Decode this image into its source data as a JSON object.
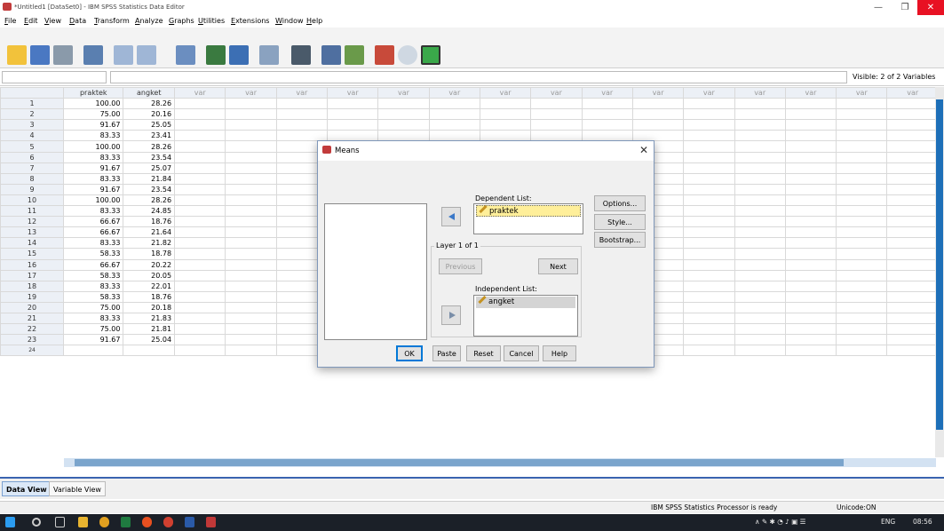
{
  "window": {
    "title": "*Untitled1 [DataSet0] - IBM SPSS Statistics Data Editor",
    "minimize": "—",
    "restore": "❐",
    "close": "✕"
  },
  "menu": [
    "File",
    "Edit",
    "View",
    "Data",
    "Transform",
    "Analyze",
    "Graphs",
    "Utilities",
    "Extensions",
    "Window",
    "Help"
  ],
  "visible": "Visible: 2 of 2 Variables",
  "grid": {
    "headers": [
      "praktek",
      "angket",
      "var",
      "var",
      "var",
      "var",
      "var",
      "var",
      "var",
      "var",
      "var",
      "var",
      "var",
      "var",
      "var",
      "var",
      "var"
    ],
    "rows": [
      [
        "1",
        "100.00",
        "28.26"
      ],
      [
        "2",
        "75.00",
        "20.16"
      ],
      [
        "3",
        "91.67",
        "25.05"
      ],
      [
        "4",
        "83.33",
        "23.41"
      ],
      [
        "5",
        "100.00",
        "28.26"
      ],
      [
        "6",
        "83.33",
        "23.54"
      ],
      [
        "7",
        "91.67",
        "25.07"
      ],
      [
        "8",
        "83.33",
        "21.84"
      ],
      [
        "9",
        "91.67",
        "23.54"
      ],
      [
        "10",
        "100.00",
        "28.26"
      ],
      [
        "11",
        "83.33",
        "24.85"
      ],
      [
        "12",
        "66.67",
        "18.76"
      ],
      [
        "13",
        "66.67",
        "21.64"
      ],
      [
        "14",
        "83.33",
        "21.82"
      ],
      [
        "15",
        "58.33",
        "18.78"
      ],
      [
        "16",
        "66.67",
        "20.22"
      ],
      [
        "17",
        "58.33",
        "20.05"
      ],
      [
        "18",
        "83.33",
        "22.01"
      ],
      [
        "19",
        "58.33",
        "18.76"
      ],
      [
        "20",
        "75.00",
        "20.18"
      ],
      [
        "21",
        "83.33",
        "21.83"
      ],
      [
        "22",
        "75.00",
        "21.81"
      ],
      [
        "23",
        "91.67",
        "25.04"
      ]
    ],
    "partial_row": "24"
  },
  "dialog": {
    "title": "Means",
    "close": "✕",
    "dependent_label": "Dependent List:",
    "dependent_items": [
      "praktek"
    ],
    "layer_label": "Layer 1 of 1",
    "previous": "Previous",
    "next": "Next",
    "independent_label": "Independent List:",
    "independent_items": [
      "angket"
    ],
    "options": "Options...",
    "style": "Style...",
    "bootstrap": "Bootstrap...",
    "ok": "OK",
    "paste": "Paste",
    "reset": "Reset",
    "cancel": "Cancel",
    "help": "Help"
  },
  "tabs": {
    "data_view": "Data View",
    "variable_view": "Variable View"
  },
  "status": {
    "processor": "IBM SPSS Statistics Processor is ready",
    "unicode": "Unicode:ON"
  },
  "taskbar": {
    "lang": "ENG",
    "time": "08:56"
  }
}
